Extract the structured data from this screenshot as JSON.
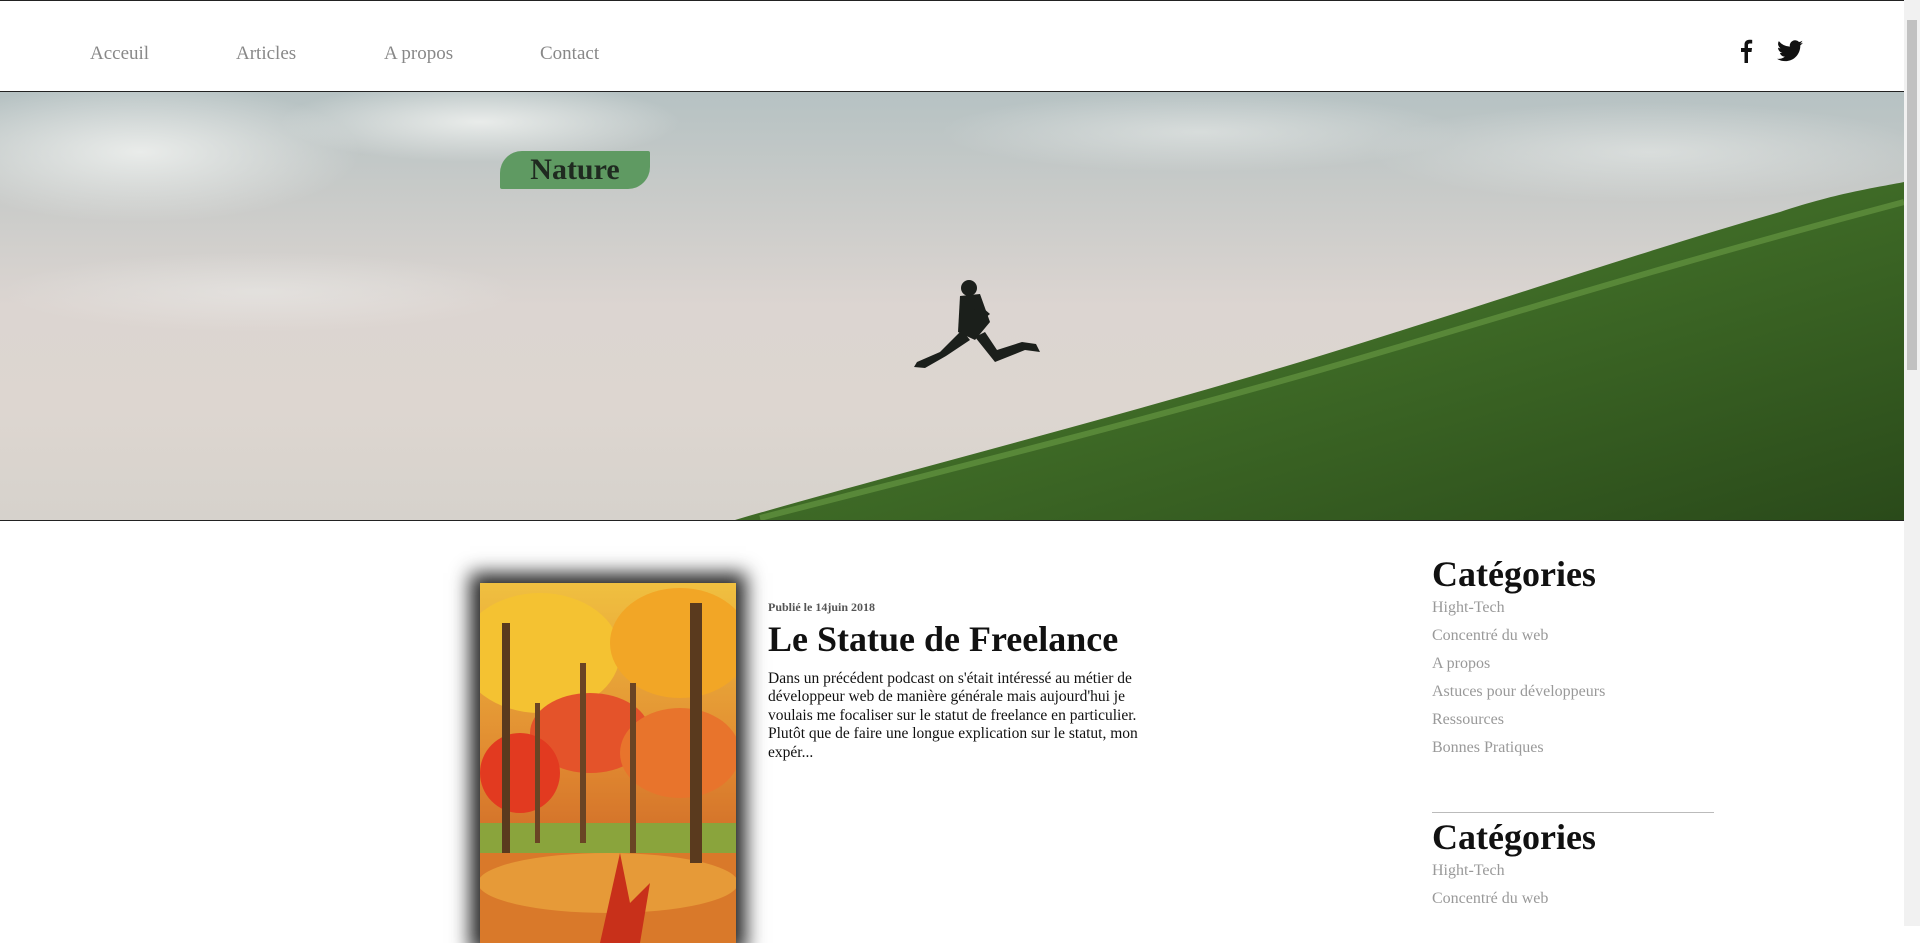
{
  "nav": {
    "items": [
      "Acceuil",
      "Articles",
      "A propos",
      "Contact"
    ]
  },
  "social": {
    "icons": [
      "facebook-icon",
      "twitter-icon"
    ]
  },
  "hero": {
    "tag": "Nature",
    "colors": {
      "tag_bg": "#5f9a62",
      "grass": "#3f6b2a"
    }
  },
  "article": {
    "meta": "Publié le 14juin 2018",
    "title": "Le Statue de Freelance",
    "excerpt": "Dans un précédent podcast on s'était intéressé au métier de développeur web de manière générale mais aujourd'hui je voulais me focaliser sur le statut de freelance en particulier. Plutôt que de faire une longue explication sur le statut, mon expér..."
  },
  "sidebar": {
    "sections": [
      {
        "heading": "Catégories",
        "items": [
          "Hight-Tech",
          "Concentré du web",
          "A propos",
          "Astuces pour développeurs",
          "Ressources",
          "Bonnes Pratiques"
        ]
      },
      {
        "heading": "Catégories",
        "items": [
          "Hight-Tech",
          "Concentré du web"
        ]
      }
    ]
  }
}
